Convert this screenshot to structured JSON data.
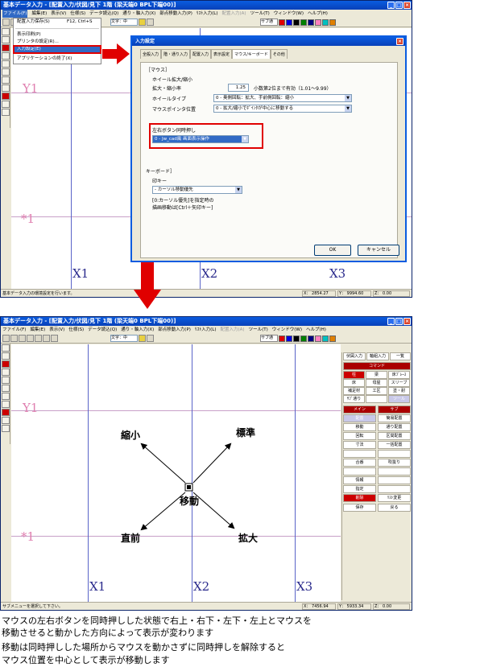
{
  "top": {
    "title": "基本データ入力 - [配置入力/伏図/見下 1階 (梁天端0 BPL下端00)]",
    "menus": [
      "ファイル(F)",
      "編集(E)",
      "表示(V)",
      "仕様(S)",
      "データ読込(Q)",
      "通り・軸入力(X)",
      "部点移動入力(P)",
      "ﾘｽﾄ入力(L)",
      "配置入力(A)",
      "ツール(T)",
      "ウィンドウ(W)",
      "ヘルプ(H)"
    ],
    "toolbar_text": "文字：中",
    "toolbar_sub": "サブ通",
    "file_menu": {
      "items": [
        {
          "label": "配置入力保存(S)",
          "shortcut": "F12, Ctrl+S"
        },
        {
          "label": "表示印刷(P)",
          "shortcut": ""
        },
        {
          "label": "プリンタの設定(R)...",
          "shortcut": ""
        },
        {
          "label": "入力設定(E)",
          "shortcut": ""
        },
        {
          "label": "アプリケーションの終了(X)",
          "shortcut": ""
        }
      ]
    },
    "grid": {
      "y1": "Y1",
      "star1": "*1",
      "x1": "X1",
      "x2": "X2",
      "x3": "X3"
    },
    "status": "基本データ入力の環境設定を行います。",
    "coord_x": "X： 2854.27",
    "coord_y": "Y： 9994.60",
    "coord_z": "Z： 0.00",
    "dialog": {
      "title": "入力設定",
      "tabs": [
        "全般入力",
        "階・通り入力",
        "配置入力",
        "表示設定",
        "マウス/キーボード",
        "その他"
      ],
      "mouse_group": "［マウス］",
      "wheel_group": "ホイール拡大/縮小",
      "zoom_rate_label": "拡大・縮小率",
      "zoom_rate_value": "1.25",
      "zoom_rate_note": "小数第2位まで有効（1.01～9.99）",
      "wheel_type_label": "ホイールタイプ",
      "wheel_type_value": "0 - 奥側回転：拡大、手前側回転：縮小",
      "pointer_label": "マウスポインタ位置",
      "pointer_value": "0 - 拡大/縮小でﾎﾟｲﾝﾀが中心に移動する",
      "lr_group": "左右ボタン同時押し",
      "lr_value": "0 - Jw_cad風 画面表示操作",
      "kb_group": "キーボード］",
      "arrow_group": "印キー",
      "arrow_value": "- カーソル移動優先",
      "arrow_note1": "[0:カーソル優先]を指定時の",
      "arrow_note2": "描画移動は[Ctrl＋矢印キー]",
      "ok": "OK",
      "cancel": "キャンセル"
    }
  },
  "bottom": {
    "title": "基本データ入力 - [配置入力/伏図/見下 1階 (梁天端0 BPL下端00)]",
    "toolbar_text": "文字：中",
    "toolbar_sub": "サブ通",
    "grid": {
      "y1": "Y1",
      "star1": "*1",
      "x1": "X1",
      "x2": "X2",
      "x3": "X3"
    },
    "directions": {
      "center": "移動",
      "top_left": "縮小",
      "top_right": "標準",
      "bottom_left": "直前",
      "bottom_right": "拡大"
    },
    "status": "サブメニューを選択して下さい。",
    "coord_x": "X： 7456.94",
    "coord_y": "Y： 5933.34",
    "coord_z": "Z： 0.00",
    "panel": {
      "tabs": [
        "伏図入力",
        "軸組入力",
        "一覧"
      ],
      "command": "コマンド",
      "grid1": [
        "柱",
        "梁",
        "床ﾌﾞﾚｰｽ",
        "床",
        "母屋",
        "スリーブ",
        "補足材",
        "工区",
        "塗・耐",
        "ｻﾌﾞ通り",
        "",
        "ツール"
      ],
      "main_label": "メイン",
      "sub_label": "サブ",
      "left_col": [
        "配置",
        "移動",
        "回転",
        "寸法",
        "",
        "合番",
        "",
        "情報",
        "指定",
        "削除"
      ],
      "right_col": [
        "簡易配置",
        "通り配置",
        "区間配置",
        "一括配置",
        "",
        "吹抜り",
        "",
        "",
        "",
        "ﾘｽﾄ変更"
      ],
      "save": "保存",
      "back": "戻る"
    }
  },
  "caption": [
    "マウスの左右ボタンを同時押しした状態で右上・右下・左下・左上とマウスを",
    "移動させると動かした方向によって表示が変わります",
    "移動は同時押しした場所からマウスを動かさずに同時押しを解除すると",
    "マウス位置を中心として表示が移動します"
  ],
  "colors": {
    "title": "#0a5ce0",
    "highlight": "#e00000",
    "grid_x": "#5a64c8",
    "grid_y": "#c8a0c8"
  }
}
